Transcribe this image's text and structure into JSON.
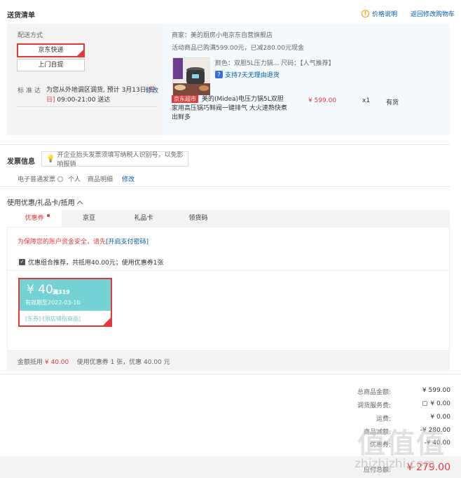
{
  "delivery": {
    "title": "送货清单",
    "price_note": "价格说明",
    "back_cart": "返回修改购物车",
    "shipping_label": "配送方式",
    "option_jd": "京东快递",
    "option_pickup": "上门自提",
    "std_label": "标准达",
    "std_text_a": "为您从外地调区调货, 预计 3月13日",
    "std_text_week": "[周日]",
    "std_text_time": " 09:00-21:00 送达",
    "std_edit": "修改",
    "merchant": "商家：美的厨房小电京东自营旗舰店",
    "promo": "活动商品已购满599.00元，已减280.00元现金",
    "color_spec": "颜色：双胆5L压力锅... 尺码：【人气推荐】",
    "seven_day": "支持7天无理由退货",
    "seven_icon": "?",
    "jd_super": "京东超市",
    "product_name": "美的(Midea)电压力锅5L双胆家用高压锅巧鲜阀一键排气 大火速熟快煮出鲜多",
    "price": "¥ 599.00",
    "qty": "x1",
    "stock": "有货"
  },
  "invoice": {
    "title": "发票信息",
    "tip": "开企业抬头发票须填写纳税人识别号，以免影响报销",
    "type": "电子普通发票",
    "personal": "个人",
    "detail": "商品明细",
    "edit": "修改"
  },
  "coupons": {
    "title": "使用优惠/礼品卡/抵用",
    "tabs": [
      "优惠券",
      "京豆",
      "礼品卡",
      "领货码"
    ],
    "safety": "为保障您的账户资金安全，请先",
    "safety_link": "[开启支付密码]",
    "combo": "优惠组合推荐，共抵用40.00元；使用优惠券1张",
    "combo_check": "✓",
    "card": {
      "amount": "¥ 40",
      "condition": "满319",
      "valid": "有效期至2022-03-10",
      "tags": "[东券]  [限店铺指商品]"
    },
    "summary_a": "金额抵用",
    "summary_amount": "¥ 40.00",
    "summary_b": "使用优惠券 1 张，优惠 40.00 元"
  },
  "totals": {
    "rows": [
      {
        "label": "总商品金额:",
        "value": "¥ 599.00"
      },
      {
        "label": "调货服务费:",
        "value": "¥ 0.00"
      },
      {
        "label": "运费:",
        "value": "¥ 0.00"
      },
      {
        "label": "商品减额:",
        "value": "-¥ 280.00"
      },
      {
        "label": "优惠券:",
        "value": "-¥ 40.00"
      }
    ],
    "pay_label": "应付总额:",
    "pay_value": "¥ 279.00"
  },
  "watermark": {
    "glyphs": "值值值",
    "text": "zhizhizhi.com"
  },
  "colors": {
    "accent": "#e4393c",
    "link": "#005ea7",
    "coupon": "#74d2d4"
  }
}
